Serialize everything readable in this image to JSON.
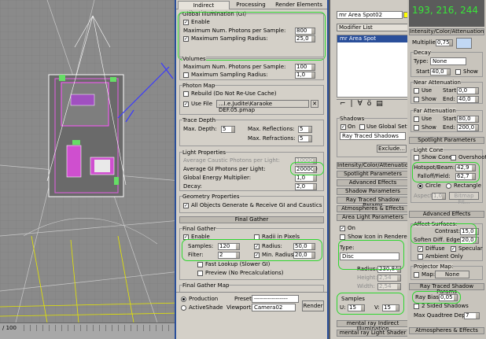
{
  "viewport": {
    "frame_counter": "/ 100"
  },
  "tabs": [
    "Indirect Illumination",
    "Processing",
    "Render Elements"
  ],
  "gi": {
    "title": "Global Illumination (GI)",
    "enable": "Enable",
    "photons_label": "Maximum Num. Photons per Sample:",
    "photons": "800",
    "radius_label": "Maximum Sampling Radius:",
    "radius": "25,0"
  },
  "volumes": {
    "title": "Volumes",
    "photons_label": "Maximum Num. Photons per Sample:",
    "photons": "100",
    "radius_label": "Maximum Sampling Radius:",
    "radius": "1,0"
  },
  "photon_map": {
    "title": "Photon Map",
    "rebuild": "Rebuild (Do Not Re-Use Cache)",
    "use_file": "Use File",
    "browse": "...",
    "path": "...I.e.Judite\\Karaoke DEF.05.pmap"
  },
  "trace_depth": {
    "title": "Trace Depth",
    "max_depth_label": "Max. Depth:",
    "max_depth": "5",
    "reflections_label": "Max. Reflections:",
    "reflections": "5",
    "refractions_label": "Max. Refractions:",
    "refractions": "5"
  },
  "light_props": {
    "title": "Light Properties",
    "caustic_label": "Average Caustic Photons per Light:",
    "caustic": "10000",
    "gi_label": "Average GI Photons per Light:",
    "gi": "200000",
    "energy_label": "Global Energy Multiplier:",
    "energy": "1,0",
    "decay_label": "Decay:",
    "decay": "2,0"
  },
  "geometry": {
    "title": "Geometry Properties",
    "all_objects": "All Objects Generate & Receive GI and Caustics"
  },
  "final_gather_bar": "Final Gather",
  "fg": {
    "title": "Final Gather",
    "enable": "Enable",
    "radii_pixels": "Radii in Pixels",
    "samples_label": "Samples:",
    "samples": "120",
    "radius_label": "Radius:",
    "radius": "50,0",
    "filter_label": "Filter:",
    "filter": "2",
    "min_radius_label": "Min. Radius:",
    "min_radius": "20,0",
    "fast_lookup": "Fast Lookup (Slower GI)",
    "preview": "Preview (No Precalculations)"
  },
  "fg_map": {
    "title": "Final Gather Map"
  },
  "footer": {
    "production": "Production",
    "activeshade": "ActiveShade",
    "preset_label": "Preset:",
    "preset": "-----------------",
    "viewport_label": "Viewport:",
    "viewport": "Camera02",
    "render": "Render"
  },
  "mid": {
    "object_name": "mr Area Spot02",
    "modifier_list": "Modifier List",
    "stack_item": "mr Area Spot",
    "shadows_title": "Shadows",
    "on": "On",
    "use_global": "Use Global Settings",
    "shadow_type": "Ray Traced Shadows",
    "exclude": "Exclude...",
    "rollouts": [
      "Intensity/Color/Attenuation",
      "Spotlight Parameters",
      "Advanced Effects",
      "Shadow Parameters",
      "Ray Traced Shadow Params",
      "Atmospheres & Effects",
      "Area Light Parameters"
    ],
    "area_on": "On",
    "show_icon": "Show Icon in Renderer",
    "type_label": "Type:",
    "type": "Disc",
    "radius_label": "Radius:",
    "radius": "230,84",
    "height_label": "Height:",
    "height": "2,54",
    "width_label": "Width:",
    "width": "2,54",
    "samples_label": "Samples",
    "u_label": "U:",
    "u": "15",
    "v_label": "V:",
    "v": "15",
    "indirect": "mental ray Indirect Illumination",
    "light_shader": "mental ray Light Shader"
  },
  "right": {
    "rgb_readout": "193, 216, 244",
    "intensity_bar": "Intensity/Color/Attenuation",
    "multiplier_label": "Multiplier:",
    "multiplier": "0,75",
    "decay_title": "Decay",
    "decay_type_label": "Type:",
    "decay_type": "None",
    "decay_start_label": "Start:",
    "decay_start": "40,0",
    "decay_show": "Show",
    "near_title": "Near Attenuation",
    "use": "Use",
    "show": "Show",
    "near_start_label": "Start:",
    "near_start": "0,0",
    "near_end_label": "End:",
    "near_end": "40,0",
    "far_title": "Far Attenuation",
    "far_start_label": "Start:",
    "far_start": "80,0",
    "far_end_label": "End:",
    "far_end": "200,0",
    "spot_bar": "Spotlight Parameters",
    "cone_title": "Light Cone",
    "show_cone": "Show Cone",
    "overshoot": "Overshoot",
    "hotspot_label": "Hotspot/Beam:",
    "hotspot": "42,9",
    "falloff_label": "Falloff/Field:",
    "falloff": "62,7",
    "circle": "Circle",
    "rectangle": "Rectangle",
    "aspect_label": "Aspect:",
    "aspect": "1,0",
    "bitmap_fit": "Bitmap Fit...",
    "adv_bar": "Advanced Effects",
    "affect_title": "Affect Surfaces:",
    "contrast_label": "Contrast:",
    "contrast": "15,0",
    "soften_label": "Soften Diff. Edge:",
    "soften": "20,0",
    "diffuse": "Diffuse",
    "specular": "Specular",
    "ambient_only": "Ambient Only",
    "projector_title": "Projector Map:",
    "map_label": "Map:",
    "map_none": "None",
    "rts_bar": "Ray Traced Shadow Params",
    "ray_bias_label": "Ray Bias:",
    "ray_bias": "0,05",
    "two_sided": "2 Sided Shadows",
    "quadtree_label": "Max Quadtree Depth:",
    "quadtree": "7",
    "atmos_bar": "Atmospheres & Effects"
  },
  "colors": {
    "highlight": "#2fd62f",
    "selection_blue": "#2a4f9a",
    "light_blue_swatch": "#c1d8f4"
  }
}
